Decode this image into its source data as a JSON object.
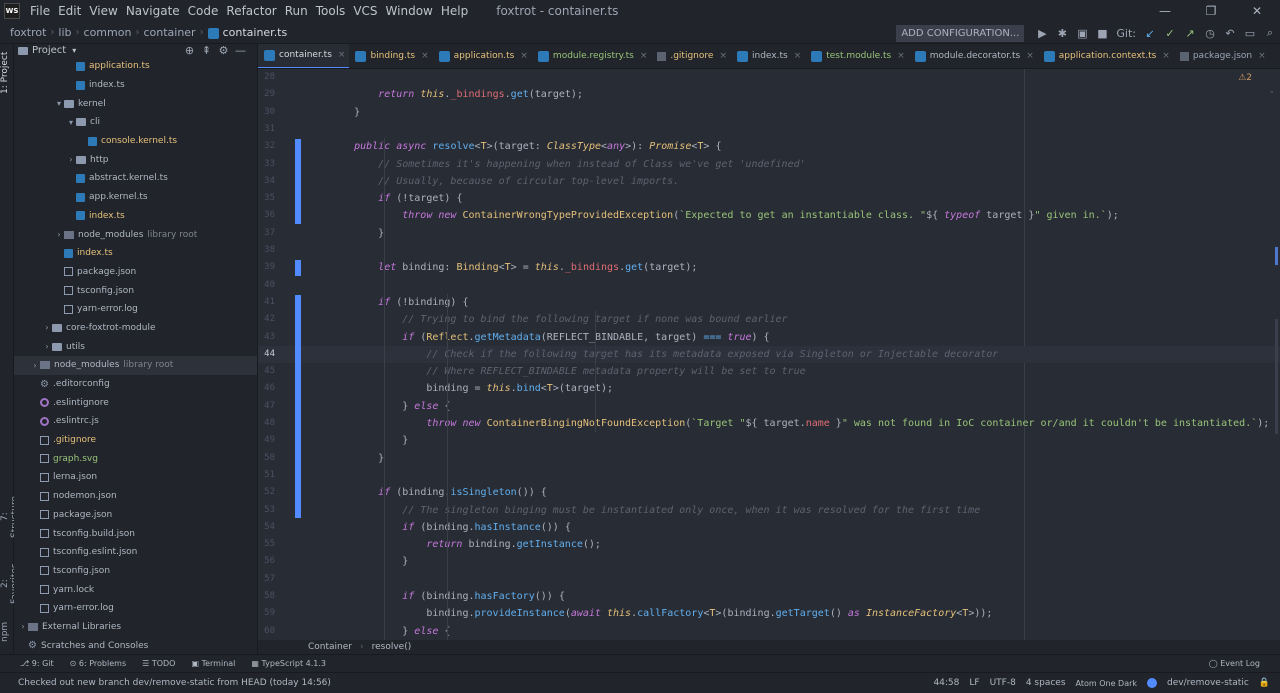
{
  "app": {
    "logo": "WS",
    "window_title": "foxtrot - container.ts",
    "menu": [
      "File",
      "Edit",
      "View",
      "Navigate",
      "Code",
      "Refactor",
      "Run",
      "Tools",
      "VCS",
      "Window",
      "Help"
    ]
  },
  "navbar": {
    "breadcrumbs": [
      "foxtrot",
      "lib",
      "common",
      "container",
      "container.ts"
    ],
    "add_configuration": "ADD CONFIGURATION...",
    "git_label": "Git:"
  },
  "side_tabs": {
    "project": "1: Project",
    "structure": "7: Structure",
    "favorites": "2: Favorites",
    "npm": "npm"
  },
  "project_panel": {
    "title": "Project",
    "tree": [
      {
        "label": "application.ts",
        "icon": "ts",
        "depth": 4,
        "color": "yellow"
      },
      {
        "label": "index.ts",
        "icon": "ts",
        "depth": 4,
        "color": ""
      },
      {
        "label": "kernel",
        "icon": "folder",
        "depth": 3,
        "arrow": "open",
        "color": ""
      },
      {
        "label": "cli",
        "icon": "folder",
        "depth": 4,
        "arrow": "open",
        "color": ""
      },
      {
        "label": "console.kernel.ts",
        "icon": "ts",
        "depth": 5,
        "color": "yellow"
      },
      {
        "label": "http",
        "icon": "folder",
        "depth": 4,
        "arrow": "closed",
        "color": ""
      },
      {
        "label": "abstract.kernel.ts",
        "icon": "ts",
        "depth": 4,
        "color": ""
      },
      {
        "label": "app.kernel.ts",
        "icon": "ts",
        "depth": 4,
        "color": ""
      },
      {
        "label": "index.ts",
        "icon": "ts",
        "depth": 4,
        "color": "yellow"
      },
      {
        "label": "node_modules",
        "suffix": "library root",
        "icon": "lib",
        "depth": 3,
        "arrow": "closed",
        "color": ""
      },
      {
        "label": "index.ts",
        "icon": "ts",
        "depth": 3,
        "color": "yellow"
      },
      {
        "label": "package.json",
        "icon": "json",
        "depth": 3,
        "color": ""
      },
      {
        "label": "tsconfig.json",
        "icon": "json",
        "depth": 3,
        "color": ""
      },
      {
        "label": "yarn-error.log",
        "icon": "json",
        "depth": 3,
        "color": ""
      },
      {
        "label": "core-foxtrot-module",
        "icon": "folder",
        "depth": 2,
        "arrow": "closed",
        "color": ""
      },
      {
        "label": "utils",
        "icon": "folder",
        "depth": 2,
        "arrow": "closed",
        "color": ""
      },
      {
        "label": "node_modules",
        "suffix": "library root",
        "icon": "lib",
        "depth": 1,
        "arrow": "closed",
        "color": "",
        "selected": true
      },
      {
        "label": ".editorconfig",
        "icon": "gear",
        "depth": 1,
        "color": ""
      },
      {
        "label": ".eslintignore",
        "icon": "eslint",
        "depth": 1,
        "color": ""
      },
      {
        "label": ".eslintrc.js",
        "icon": "eslint",
        "depth": 1,
        "color": ""
      },
      {
        "label": ".gitignore",
        "icon": "json",
        "depth": 1,
        "color": "yellow"
      },
      {
        "label": "graph.svg",
        "icon": "json",
        "depth": 1,
        "color": "green"
      },
      {
        "label": "lerna.json",
        "icon": "json",
        "depth": 1,
        "color": ""
      },
      {
        "label": "nodemon.json",
        "icon": "json",
        "depth": 1,
        "color": ""
      },
      {
        "label": "package.json",
        "icon": "json",
        "depth": 1,
        "color": ""
      },
      {
        "label": "tsconfig.build.json",
        "icon": "json",
        "depth": 1,
        "color": ""
      },
      {
        "label": "tsconfig.eslint.json",
        "icon": "json",
        "depth": 1,
        "color": ""
      },
      {
        "label": "tsconfig.json",
        "icon": "json",
        "depth": 1,
        "color": ""
      },
      {
        "label": "yarn.lock",
        "icon": "json",
        "depth": 1,
        "color": ""
      },
      {
        "label": "yarn-error.log",
        "icon": "json",
        "depth": 1,
        "color": ""
      },
      {
        "label": "External Libraries",
        "icon": "lib",
        "depth": 0,
        "arrow": "closed",
        "color": ""
      },
      {
        "label": "Scratches and Consoles",
        "icon": "gear",
        "depth": 0,
        "color": ""
      }
    ]
  },
  "tabs": [
    {
      "label": "container.ts",
      "active": true,
      "color": ""
    },
    {
      "label": "binding.ts",
      "color": "yellow"
    },
    {
      "label": "application.ts",
      "color": "yellow"
    },
    {
      "label": "module.registry.ts",
      "color": "green"
    },
    {
      "label": ".gitignore",
      "color": "yellow"
    },
    {
      "label": "index.ts",
      "color": ""
    },
    {
      "label": "test.module.ts",
      "color": "green"
    },
    {
      "label": "module.decorator.ts",
      "color": ""
    },
    {
      "label": "application.context.ts",
      "color": "yellow"
    },
    {
      "label": "package.json",
      "color": "",
      "dim": true
    }
  ],
  "editor": {
    "warning": "⚠2",
    "lines": [
      {
        "n": "28",
        "html": ""
      },
      {
        "n": "29",
        "html": "        <span class=\"kw\">return</span> <span class=\"th\">this</span>.<span class=\"pr\">_bindings</span>.<span class=\"fn\">get</span>(target);"
      },
      {
        "n": "30",
        "html": "    }"
      },
      {
        "n": "31",
        "html": ""
      },
      {
        "n": "32",
        "html": "    <span class=\"kw\">public</span> <span class=\"kw\">async</span> <span class=\"fn\">resolve</span>&lt;<span class=\"ty\">T</span>&gt;(target: <span class=\"tyi\">ClassType</span>&lt;<span class=\"kw\">any</span>&gt;): <span class=\"tyi\">Promise</span>&lt;<span class=\"ty\">T</span>&gt; {"
      },
      {
        "n": "33",
        "html": "        <span class=\"cm\">// Sometimes it's happening when instead of Class we've get 'undefined'</span>"
      },
      {
        "n": "34",
        "html": "        <span class=\"cm\">// Usually, because of circular top-level imports.</span>"
      },
      {
        "n": "35",
        "html": "        <span class=\"kw\">if</span> (!target) {"
      },
      {
        "n": "36",
        "html": "            <span class=\"kw\">throw</span> <span class=\"kw\">new</span> <span class=\"ty\">ContainerWrongTypeProvidedException</span>(<span class=\"str\">`Expected to get an instantiable class. \"</span>${ <span class=\"kw\">typeof</span> target }<span class=\"str\">\" given in.`</span>);"
      },
      {
        "n": "37",
        "html": "        }"
      },
      {
        "n": "38",
        "html": ""
      },
      {
        "n": "39",
        "html": "        <span class=\"kw\">let</span> binding: <span class=\"ty\">Binding</span>&lt;<span class=\"ty\">T</span>&gt; = <span class=\"th\">this</span>.<span class=\"pr\">_bindings</span>.<span class=\"fn\">get</span>(target);"
      },
      {
        "n": "40",
        "html": ""
      },
      {
        "n": "41",
        "html": "        <span class=\"kw\">if</span> (!binding) {"
      },
      {
        "n": "42",
        "html": "            <span class=\"cm\">// Trying to bind the following target if none was bound earlier</span>"
      },
      {
        "n": "43",
        "html": "            <span class=\"kw\">if</span> (<span class=\"ty\">Reflect</span>.<span class=\"fn\">getMetadata</span>(REFLECT_BINDABLE, target) <span class=\"fn\">===</span> <span class=\"kw\">true</span>) {"
      },
      {
        "n": "44",
        "html": "                <span class=\"cm\">// Check if the following target has its metadata exposed via Singleton or Injectable decorator</span>",
        "current": true
      },
      {
        "n": "45",
        "html": "                <span class=\"cm\">// Where REFLECT_BINDABLE metadata property will be set to true</span>"
      },
      {
        "n": "46",
        "html": "                binding = <span class=\"th\">this</span>.<span class=\"fn\">bind</span>&lt;<span class=\"ty\">T</span>&gt;(target);"
      },
      {
        "n": "47",
        "html": "            } <span class=\"kw\">else</span> {"
      },
      {
        "n": "48",
        "html": "                <span class=\"kw\">throw</span> <span class=\"kw\">new</span> <span class=\"ty\">ContainerBingingNotFoundException</span>(<span class=\"str\">`Target \"</span>${ target.<span class=\"pr\">name</span> }<span class=\"str\">\" was not found in IoC container or/and it couldn't be instantiated.`</span>);"
      },
      {
        "n": "49",
        "html": "            }"
      },
      {
        "n": "50",
        "html": "        }"
      },
      {
        "n": "51",
        "html": ""
      },
      {
        "n": "52",
        "html": "        <span class=\"kw\">if</span> (binding.<span class=\"fn\">isSingleton</span>()) {"
      },
      {
        "n": "53",
        "html": "            <span class=\"cm\">// The singleton binging must be instantiated only once, when it was resolved for the first time</span>"
      },
      {
        "n": "54",
        "html": "            <span class=\"kw\">if</span> (binding.<span class=\"fn\">hasInstance</span>()) {"
      },
      {
        "n": "55",
        "html": "                <span class=\"kw\">return</span> binding.<span class=\"fn\">getInstance</span>();"
      },
      {
        "n": "56",
        "html": "            }"
      },
      {
        "n": "57",
        "html": ""
      },
      {
        "n": "58",
        "html": "            <span class=\"kw\">if</span> (binding.<span class=\"fn\">hasFactory</span>()) {"
      },
      {
        "n": "59",
        "html": "                binding.<span class=\"fn\">provideInstance</span>(<span class=\"kw\">await</span> <span class=\"th\">this</span>.<span class=\"fn\">callFactory</span>&lt;<span class=\"ty\">T</span>&gt;(binding.<span class=\"fn\">getTarget</span>() <span class=\"kw\">as</span> <span class=\"tyi\">InstanceFactory</span>&lt;<span class=\"ty\">T</span>&gt;));"
      },
      {
        "n": "60",
        "html": "            } <span class=\"kw\">else</span> {"
      }
    ]
  },
  "editor_breadcrumb": [
    "Container",
    "resolve()"
  ],
  "tool_windows": [
    "9: Git",
    "6: Problems",
    "TODO",
    "Terminal",
    "TypeScript 4.1.3"
  ],
  "event_log": "Event Log",
  "status": {
    "message": "Checked out new branch dev/remove-static from HEAD (today 14:56)",
    "position": "44:58",
    "line_sep": "LF",
    "encoding": "UTF-8",
    "indent": "4 spaces",
    "theme": "Atom One Dark",
    "branch": "dev/remove-static"
  }
}
